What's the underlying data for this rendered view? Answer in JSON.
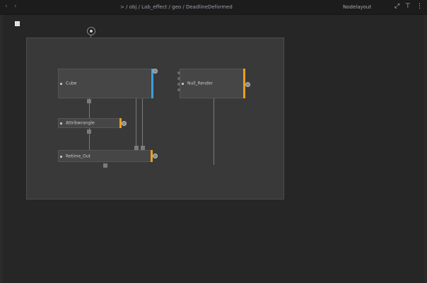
{
  "window": {
    "nav_back": "‹",
    "nav_forward": "›",
    "breadcrumb_path": "> / obj / Lab_effect / geo / DeadlineDeformed",
    "breadcrumb_node": "",
    "view_mode": "Nodelayout",
    "tools": {
      "pin": "⤢",
      "tree": "⊤",
      "menu": "⋮"
    }
  },
  "colors": {
    "accent_orange": "#e8a11a",
    "accent_blue": "#3ca0d8",
    "node_bg": "#464646",
    "network_bg": "#393939"
  },
  "nodes": [
    {
      "id": "node-1",
      "label": "Cube",
      "flag": "blue"
    },
    {
      "id": "node-2",
      "label": "Attribwrangle",
      "flag": "orange"
    },
    {
      "id": "node-3",
      "label": "Retime_Out",
      "flag": "orange"
    },
    {
      "id": "node-4",
      "label": "Null_Render",
      "flag": "orange"
    }
  ]
}
